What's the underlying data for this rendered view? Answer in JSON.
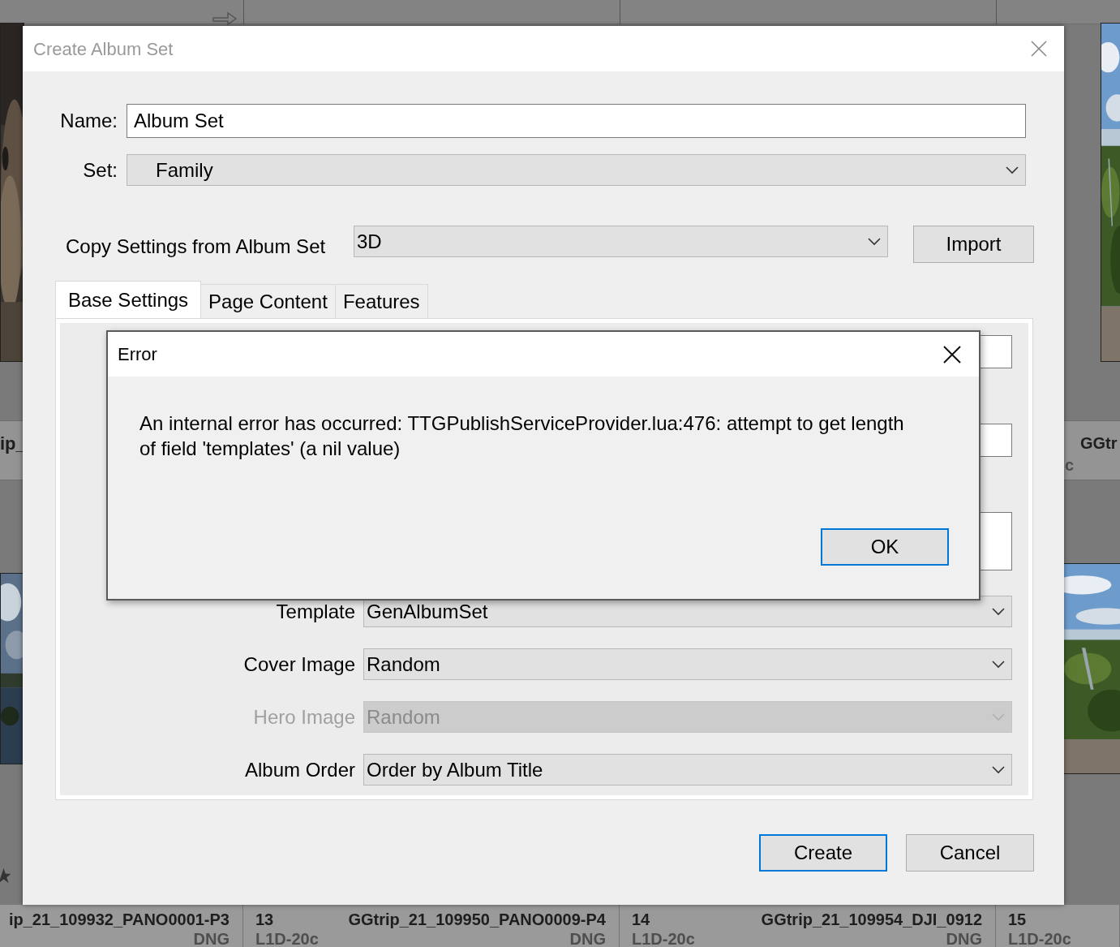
{
  "background": {
    "middle_labels": [
      {
        "text": "ip_",
        "kind": "left"
      },
      {
        "text": "GGtr",
        "kind": "right"
      },
      {
        "text": "c",
        "kind": "camera"
      }
    ],
    "info_cells": [
      {
        "name": "ip_21_109932_PANO0001-P3",
        "type": "DNG"
      },
      {
        "number": "13",
        "name": "GGtrip_21_109950_PANO0009-P4",
        "camera": "L1D-20c",
        "type": "DNG"
      },
      {
        "number": "14",
        "name": "GGtrip_21_109954_DJI_0912",
        "camera": "L1D-20c",
        "type": "DNG"
      },
      {
        "number": "15",
        "camera": "L1D-20c"
      }
    ]
  },
  "dialog": {
    "title": "Create Album Set",
    "name_label": "Name:",
    "name_value": "Album Set",
    "set_label": "Set:",
    "set_value": "Family",
    "copy_label": "Copy Settings from Album Set",
    "copy_value": "3D",
    "import_button": "Import",
    "tabs": [
      {
        "label": "Base Settings",
        "selected": true
      },
      {
        "label": "Page Content",
        "selected": false
      },
      {
        "label": "Features",
        "selected": false
      }
    ],
    "partial_fields": [
      {
        "kind": "single"
      },
      {
        "kind": "single"
      },
      {
        "kind": "multi"
      }
    ],
    "rows": [
      {
        "label": "Template",
        "value": "GenAlbumSet",
        "disabled": false
      },
      {
        "label": "Cover Image",
        "value": "Random",
        "disabled": false
      },
      {
        "label": "Hero Image",
        "value": "Random",
        "disabled": true
      },
      {
        "label": "Album Order",
        "value": "Order by Album Title",
        "disabled": false
      }
    ],
    "buttons": [
      {
        "label": "Create",
        "default": true
      },
      {
        "label": "Cancel",
        "default": false
      }
    ]
  },
  "error": {
    "title": "Error",
    "message": "An internal error has occurred: TTGPublishServiceProvider.lua:476: attempt to get length of field 'templates' (a nil value)",
    "button": "OK"
  }
}
